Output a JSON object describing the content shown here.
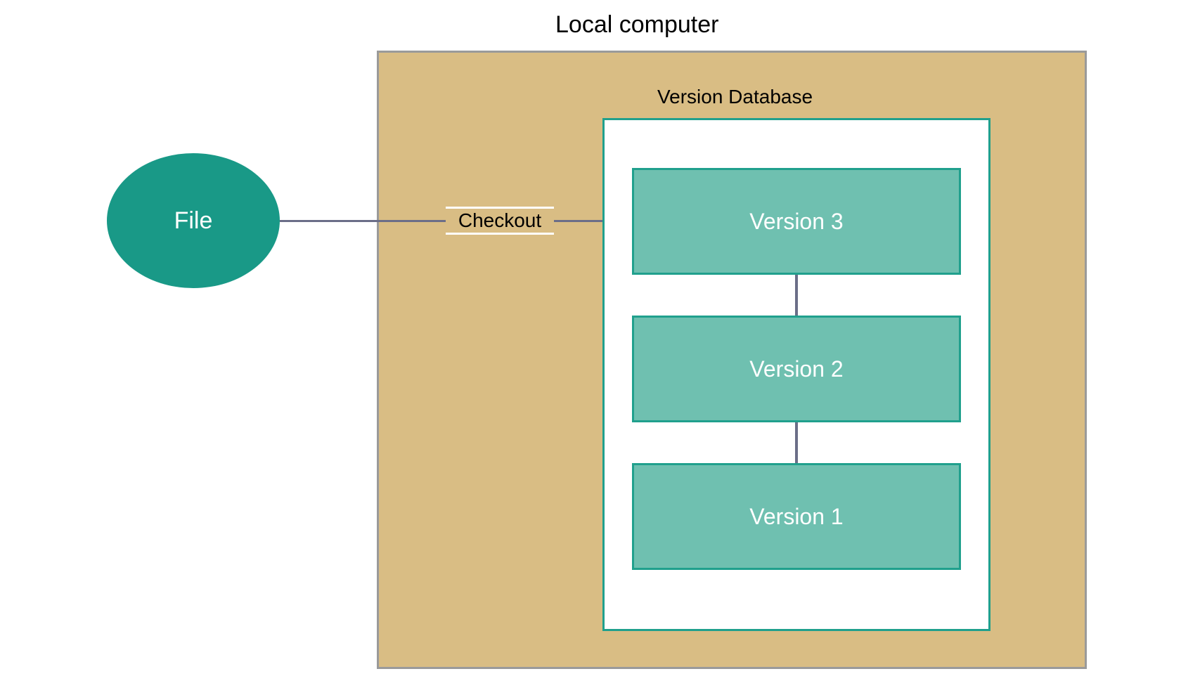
{
  "title": "Local computer",
  "file": {
    "label": "File"
  },
  "edge": {
    "checkout_label": "Checkout"
  },
  "database": {
    "title": "Version Database",
    "versions": {
      "v3": "Version 3",
      "v2": "Version 2",
      "v1": "Version 1"
    }
  }
}
